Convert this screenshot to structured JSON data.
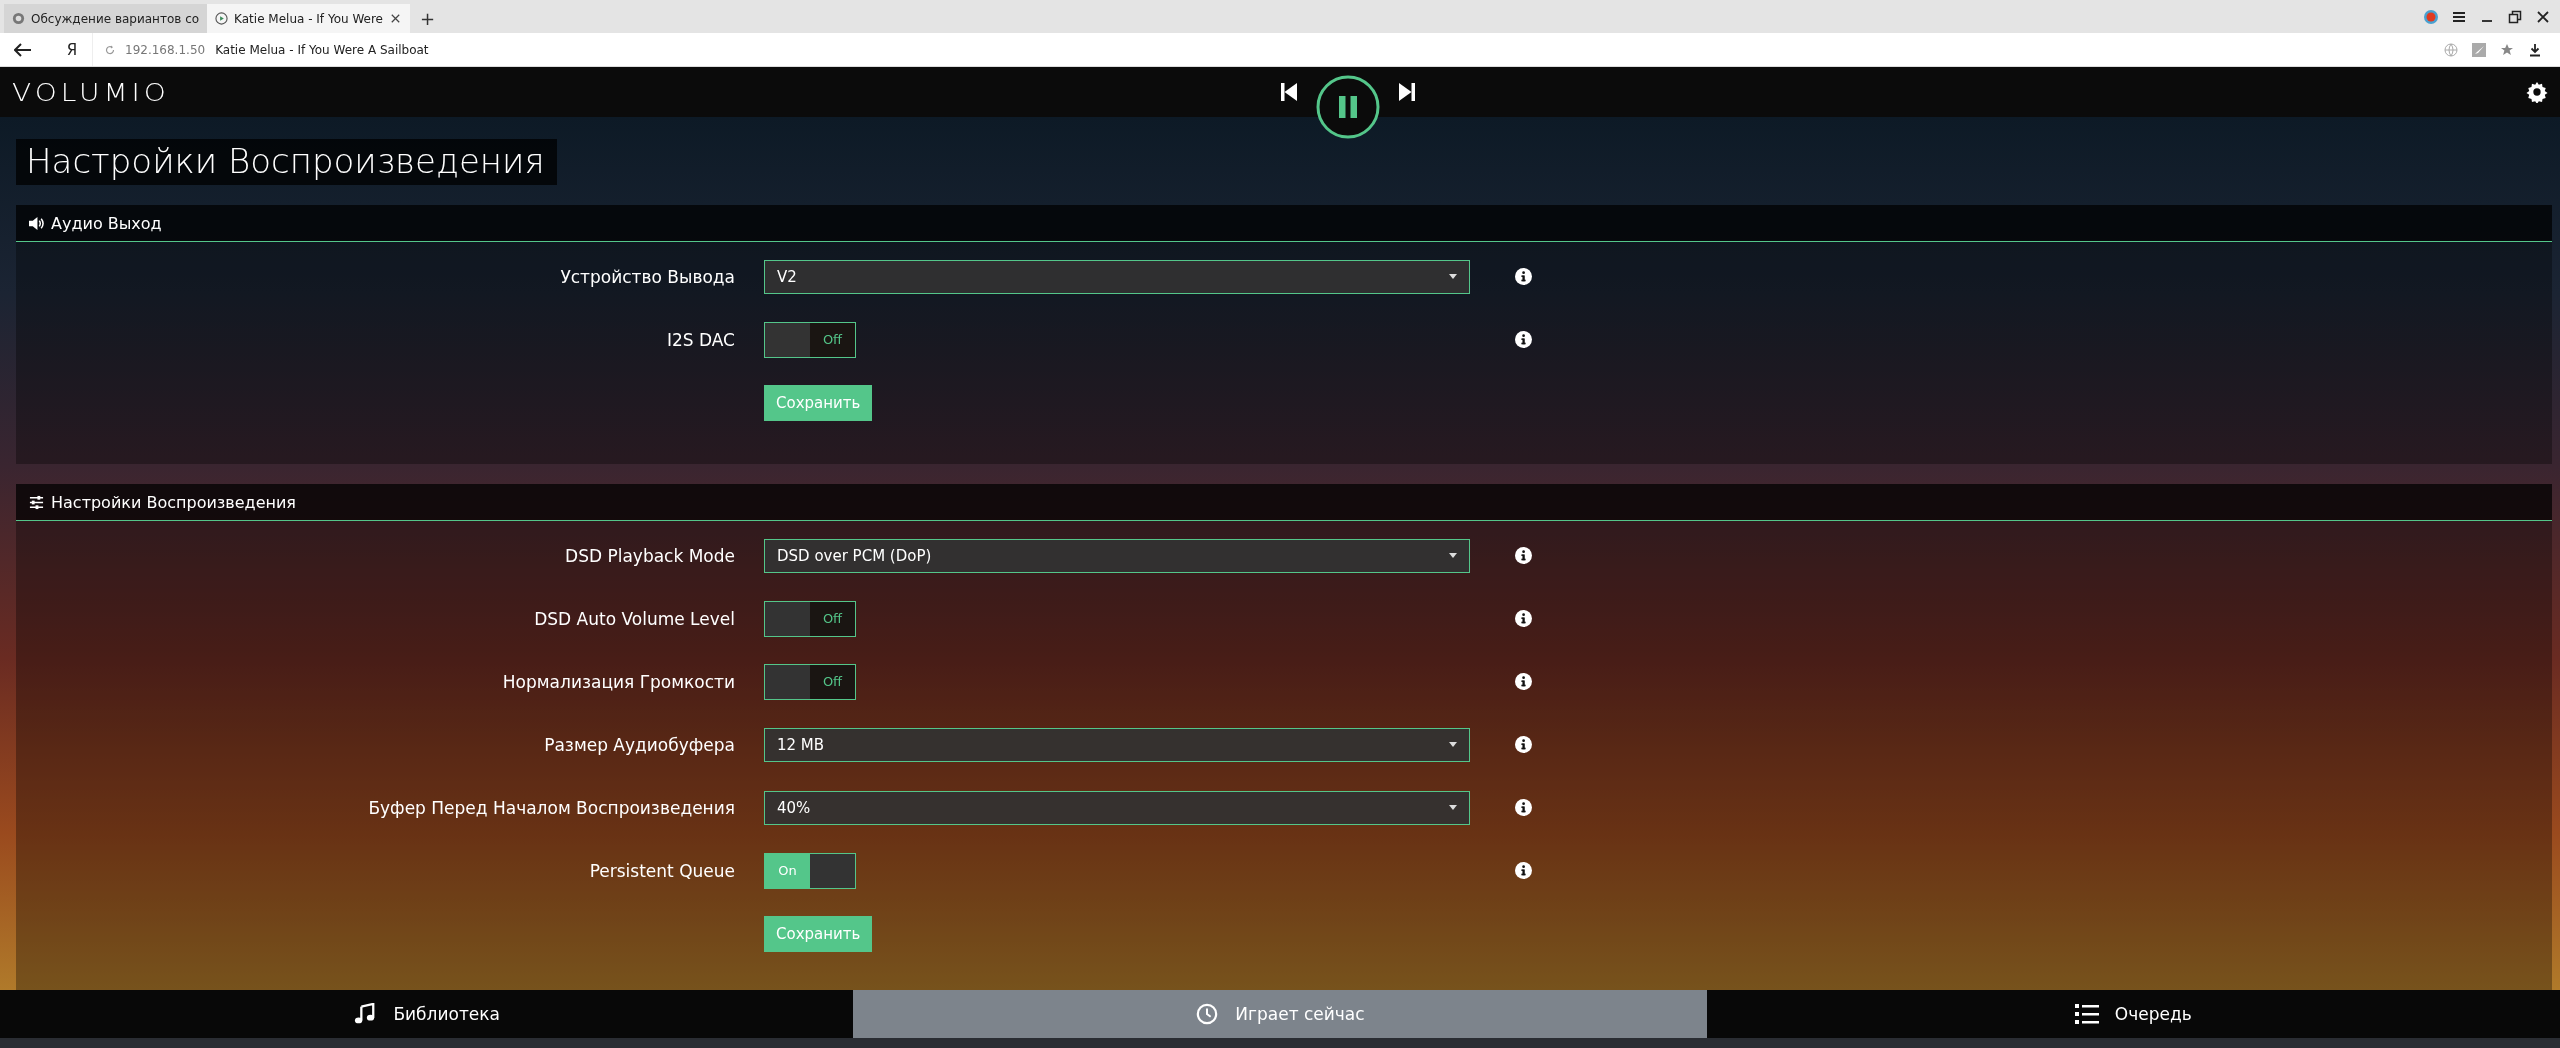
{
  "browser": {
    "tabs": [
      {
        "label": "Обсуждение вариантов со",
        "selected": false
      },
      {
        "label": "Katie Melua - If You Were",
        "selected": true
      }
    ],
    "new_tab": "+",
    "home": "Я",
    "address": {
      "host": "192.168.1.50",
      "title": "Katie Melua - If You Were A Sailboat"
    }
  },
  "header": {
    "logo": "VOLUMIO"
  },
  "page_title": "Настройки Воспроизведения",
  "sections": [
    {
      "title": "Аудио Выход",
      "rows": [
        {
          "kind": "select",
          "label": "Устройство Вывода",
          "value": "V2"
        },
        {
          "kind": "toggle",
          "label": "I2S DAC",
          "on": false,
          "state_label": "Off"
        }
      ],
      "save": "Сохранить"
    },
    {
      "title": "Настройки Воспроизведения",
      "rows": [
        {
          "kind": "select",
          "label": "DSD Playback Mode",
          "value": "DSD over PCM (DoP)"
        },
        {
          "kind": "toggle",
          "label": "DSD Auto Volume Level",
          "on": false,
          "state_label": "Off"
        },
        {
          "kind": "toggle",
          "label": "Нормализация Громкости",
          "on": false,
          "state_label": "Off"
        },
        {
          "kind": "select",
          "label": "Размер Аудиобуфера",
          "value": "12 MB"
        },
        {
          "kind": "select",
          "label": "Буфер Перед Началом Воспроизведения",
          "value": "40%"
        },
        {
          "kind": "toggle",
          "label": "Persistent Queue",
          "on": true,
          "state_label": "On"
        }
      ],
      "save": "Сохранить"
    }
  ],
  "nav": [
    {
      "label": "Библиотека",
      "selected": false
    },
    {
      "label": "Играет сейчас",
      "selected": true
    },
    {
      "label": "Очередь",
      "selected": false
    }
  ]
}
